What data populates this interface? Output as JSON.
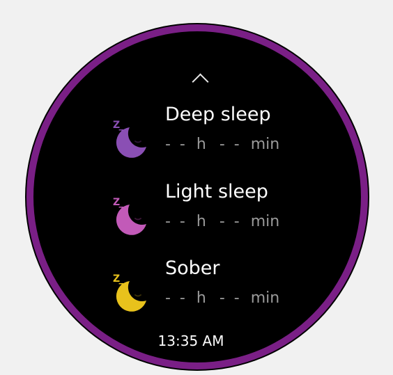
{
  "sleep_stages": [
    {
      "label": "Deep sleep",
      "hours": "- -",
      "hours_unit": "h",
      "minutes": "- -",
      "minutes_unit": "min",
      "icon": "moon-sleep-icon",
      "color": "#8a4fb4"
    },
    {
      "label": "Light sleep",
      "hours": "- -",
      "hours_unit": "h",
      "minutes": "- -",
      "minutes_unit": "min",
      "icon": "moon-sleep-icon",
      "color": "#c25ab8"
    },
    {
      "label": "Sober",
      "hours": "- -",
      "hours_unit": "h",
      "minutes": "- -",
      "minutes_unit": "min",
      "icon": "moon-sleep-icon",
      "color": "#e8c21c"
    }
  ],
  "navigation": {
    "scroll_up_icon": "chevron-up-icon"
  },
  "status": {
    "time": "13:35 AM"
  },
  "colors": {
    "bezel": "#7a1f86",
    "screen": "#000000",
    "background": "#f1f1f1",
    "text_primary": "#ffffff",
    "text_secondary": "#9a9a9a"
  }
}
